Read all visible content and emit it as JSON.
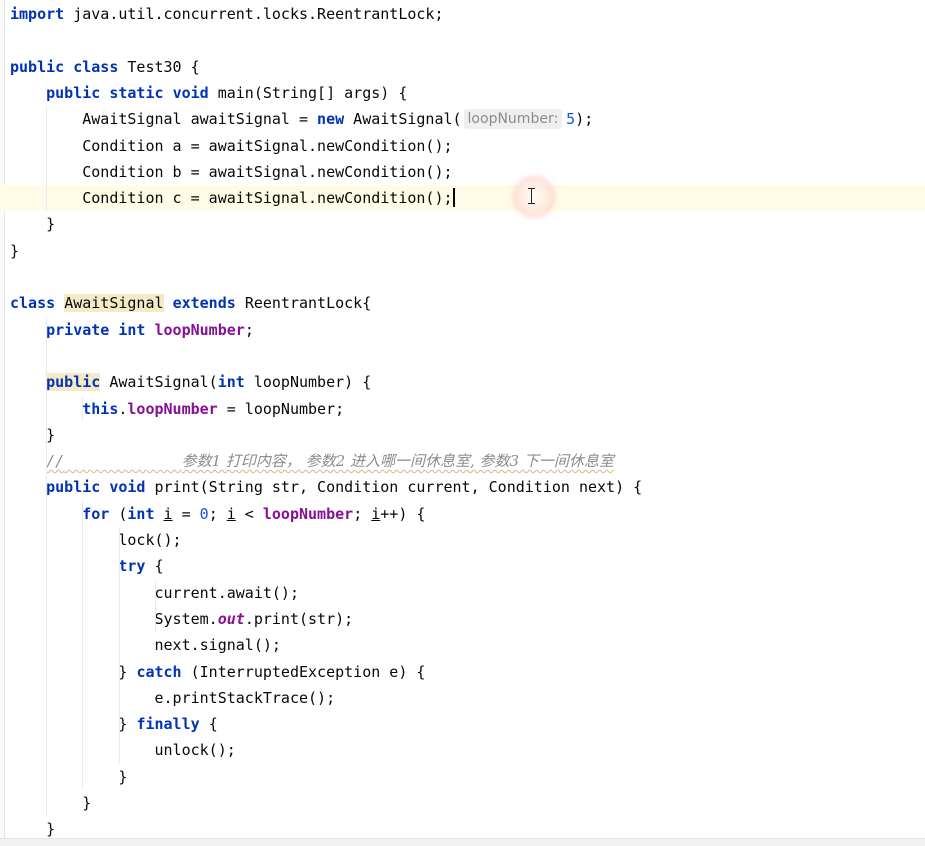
{
  "editor": {
    "hint_label": "loopNumber:",
    "lines": [
      [
        {
          "t": "import ",
          "c": "kw"
        },
        {
          "t": "java.util.concurrent.locks.ReentrantLock;",
          "c": "plain"
        }
      ],
      [],
      [
        {
          "t": "public ",
          "c": "kw"
        },
        {
          "t": "class ",
          "c": "kw"
        },
        {
          "t": "Test30 {",
          "c": "plain"
        }
      ],
      [
        {
          "t": "    ",
          "c": "plain"
        },
        {
          "t": "public ",
          "c": "kw"
        },
        {
          "t": "static ",
          "c": "kw"
        },
        {
          "t": "void ",
          "c": "kw"
        },
        {
          "t": "main(String[] args) {",
          "c": "plain"
        }
      ],
      [
        {
          "t": "        AwaitSignal awaitSignal = ",
          "c": "plain"
        },
        {
          "t": "new ",
          "c": "kw"
        },
        {
          "t": "AwaitSignal(",
          "c": "plain"
        },
        {
          "hint": "loopNumber:"
        },
        {
          "t": "5",
          "c": "num"
        },
        {
          "t": ");",
          "c": "plain"
        }
      ],
      [
        {
          "t": "        Condition a = awaitSignal.newCondition();",
          "c": "plain"
        }
      ],
      [
        {
          "t": "        Condition b = awaitSignal.newCondition();",
          "c": "plain"
        }
      ],
      [
        {
          "t": "        Condition c = awaitSignal.newCondition();",
          "c": "plain"
        },
        {
          "caret": true
        }
      ],
      [
        {
          "t": "    }",
          "c": "plain"
        }
      ],
      [
        {
          "t": "}",
          "c": "plain"
        }
      ],
      [],
      [
        {
          "t": "class ",
          "c": "kw"
        },
        {
          "t": "AwaitSignal",
          "c": "plain hl"
        },
        {
          "t": " ",
          "c": "plain"
        },
        {
          "t": "extends ",
          "c": "kw"
        },
        {
          "t": "ReentrantLock{",
          "c": "plain"
        }
      ],
      [
        {
          "t": "    ",
          "c": "plain"
        },
        {
          "t": "private ",
          "c": "kw"
        },
        {
          "t": "int ",
          "c": "kw"
        },
        {
          "t": "loopNumber",
          "c": "field"
        },
        {
          "t": ";",
          "c": "plain"
        }
      ],
      [],
      [
        {
          "t": "    ",
          "c": "plain"
        },
        {
          "t": "public",
          "c": "kw hl"
        },
        {
          "t": " AwaitSignal(",
          "c": "plain"
        },
        {
          "t": "int ",
          "c": "kw"
        },
        {
          "t": "loopNumber) {",
          "c": "plain"
        }
      ],
      [
        {
          "t": "        ",
          "c": "plain"
        },
        {
          "t": "this",
          "c": "kw"
        },
        {
          "t": ".",
          "c": "plain"
        },
        {
          "t": "loopNumber",
          "c": "field"
        },
        {
          "t": " = loopNumber;",
          "c": "plain"
        }
      ],
      [
        {
          "t": "    }",
          "c": "plain"
        }
      ],
      [
        {
          "t": "    ",
          "c": "plain"
        },
        {
          "t": "//",
          "c": "comment squiggle"
        },
        {
          "t": "             ",
          "c": "comment squiggle"
        },
        {
          "t": "参数1 打印内容， 参数2 进入哪一间休息室, 参数3 下一间休息室",
          "c": "comment-cn squiggle"
        }
      ],
      [
        {
          "t": "    ",
          "c": "plain"
        },
        {
          "t": "public ",
          "c": "kw"
        },
        {
          "t": "void ",
          "c": "kw"
        },
        {
          "t": "print(String str, Condition current, Condition next) {",
          "c": "plain"
        }
      ],
      [
        {
          "t": "        ",
          "c": "plain"
        },
        {
          "t": "for ",
          "c": "kw"
        },
        {
          "t": "(",
          "c": "plain"
        },
        {
          "t": "int ",
          "c": "kw"
        },
        {
          "t": "i",
          "c": "plain ul"
        },
        {
          "t": " = ",
          "c": "plain"
        },
        {
          "t": "0",
          "c": "num"
        },
        {
          "t": "; ",
          "c": "plain"
        },
        {
          "t": "i",
          "c": "plain ul"
        },
        {
          "t": " < ",
          "c": "plain"
        },
        {
          "t": "loopNumber",
          "c": "field"
        },
        {
          "t": "; ",
          "c": "plain"
        },
        {
          "t": "i",
          "c": "plain ul"
        },
        {
          "t": "++) {",
          "c": "plain"
        }
      ],
      [
        {
          "t": "            lock();",
          "c": "plain"
        }
      ],
      [
        {
          "t": "            ",
          "c": "plain"
        },
        {
          "t": "try ",
          "c": "kw"
        },
        {
          "t": "{",
          "c": "plain"
        }
      ],
      [
        {
          "t": "                current.await();",
          "c": "plain"
        }
      ],
      [
        {
          "t": "                System.",
          "c": "plain"
        },
        {
          "t": "out",
          "c": "static-field"
        },
        {
          "t": ".print(str);",
          "c": "plain"
        }
      ],
      [
        {
          "t": "                next.signal();",
          "c": "plain"
        }
      ],
      [
        {
          "t": "            } ",
          "c": "plain"
        },
        {
          "t": "catch ",
          "c": "kw"
        },
        {
          "t": "(InterruptedException e) {",
          "c": "plain"
        }
      ],
      [
        {
          "t": "                e.printStackTrace();",
          "c": "plain"
        }
      ],
      [
        {
          "t": "            } ",
          "c": "plain"
        },
        {
          "t": "finally ",
          "c": "kw"
        },
        {
          "t": "{",
          "c": "plain"
        }
      ],
      [
        {
          "t": "                unlock();",
          "c": "plain"
        }
      ],
      [
        {
          "t": "            }",
          "c": "plain"
        }
      ],
      [
        {
          "t": "        }",
          "c": "plain"
        }
      ],
      [
        {
          "t": "    }",
          "c": "plain"
        }
      ]
    ],
    "caret_line_index": 7
  },
  "colors": {
    "keyword": "#0033b3",
    "field": "#871094",
    "number": "#1750eb",
    "comment": "#8c8c8c",
    "caret_line": "#fefbe6",
    "usage_highlight": "#f4ebc6"
  }
}
